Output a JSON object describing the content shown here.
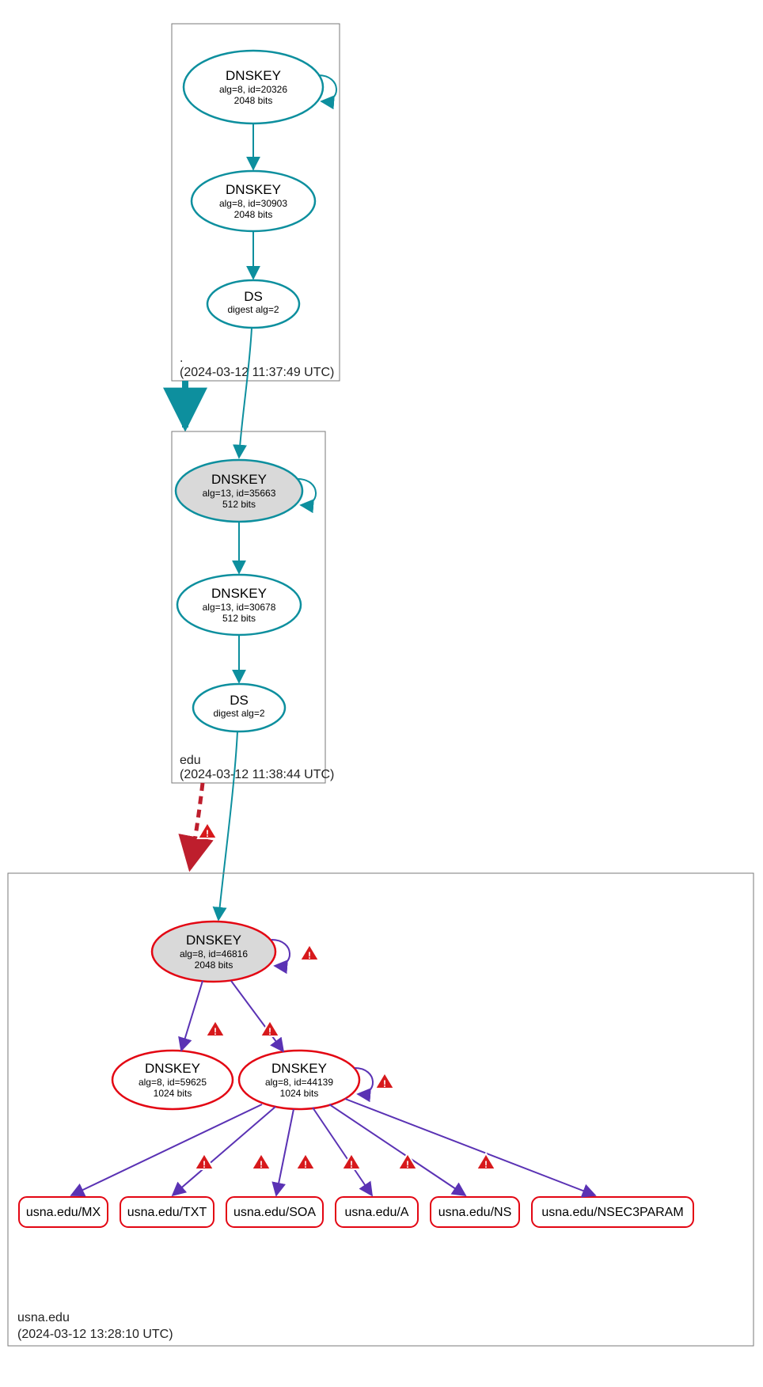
{
  "zones": {
    "root": {
      "label": ".",
      "timestamp": "(2024-03-12 11:37:49 UTC)",
      "nodes": {
        "ksk": {
          "title": "DNSKEY",
          "line1": "alg=8, id=20326",
          "line2": "2048 bits"
        },
        "zsk": {
          "title": "DNSKEY",
          "line1": "alg=8, id=30903",
          "line2": "2048 bits"
        },
        "ds": {
          "title": "DS",
          "line1": "digest alg=2"
        }
      }
    },
    "edu": {
      "label": "edu",
      "timestamp": "(2024-03-12 11:38:44 UTC)",
      "nodes": {
        "ksk": {
          "title": "DNSKEY",
          "line1": "alg=13, id=35663",
          "line2": "512 bits"
        },
        "zsk": {
          "title": "DNSKEY",
          "line1": "alg=13, id=30678",
          "line2": "512 bits"
        },
        "ds": {
          "title": "DS",
          "line1": "digest alg=2"
        }
      }
    },
    "usna": {
      "label": "usna.edu",
      "timestamp": "(2024-03-12 13:28:10 UTC)",
      "nodes": {
        "ksk": {
          "title": "DNSKEY",
          "line1": "alg=8, id=46816",
          "line2": "2048 bits"
        },
        "zsk1": {
          "title": "DNSKEY",
          "line1": "alg=8, id=59625",
          "line2": "1024 bits"
        },
        "zsk2": {
          "title": "DNSKEY",
          "line1": "alg=8, id=44139",
          "line2": "1024 bits"
        }
      },
      "leaves": {
        "mx": "usna.edu/MX",
        "txt": "usna.edu/TXT",
        "soa": "usna.edu/SOA",
        "a": "usna.edu/A",
        "ns": "usna.edu/NS",
        "n3p": "usna.edu/NSEC3PARAM"
      }
    }
  }
}
